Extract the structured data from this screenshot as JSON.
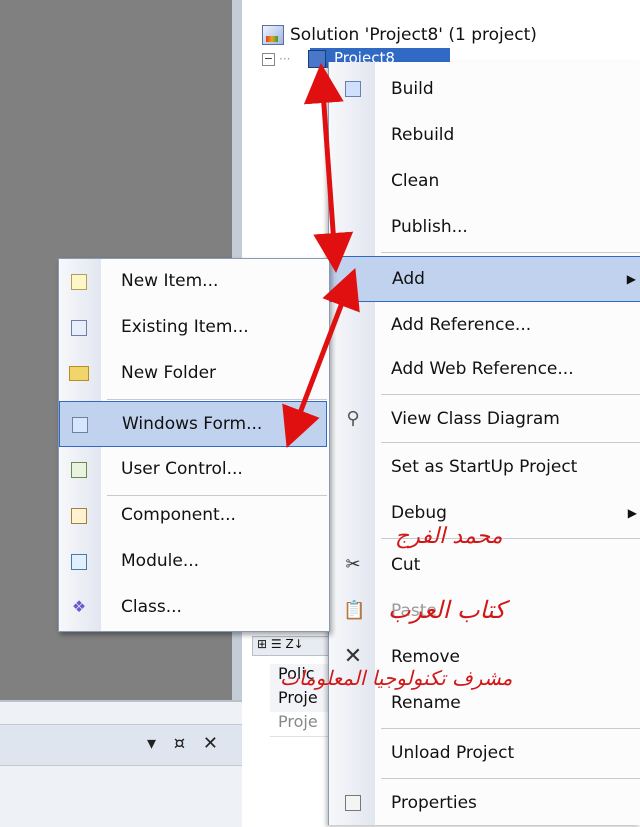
{
  "explorer": {
    "solution_label": "Solution 'Project8' (1 project)",
    "project_label": "Project8"
  },
  "context_menu": {
    "items": [
      {
        "label": "Build",
        "icon": "build-icon"
      },
      {
        "label": "Rebuild"
      },
      {
        "label": "Clean"
      },
      {
        "label": "Publish..."
      },
      {
        "label": "Add",
        "submenu": true,
        "highlighted": true
      },
      {
        "label": "Add Reference..."
      },
      {
        "label": "Add Web Reference..."
      },
      {
        "label": "View Class Diagram",
        "icon": "class-diagram-icon"
      },
      {
        "label": "Set as StartUp Project"
      },
      {
        "label": "Debug",
        "submenu": true
      },
      {
        "label": "Cut",
        "icon": "scissors-icon"
      },
      {
        "label": "Paste",
        "icon": "paste-icon",
        "disabled": true
      },
      {
        "label": "Remove",
        "icon": "remove-icon"
      },
      {
        "label": "Rename"
      },
      {
        "label": "Unload Project"
      },
      {
        "label": "Properties",
        "icon": "properties-icon"
      }
    ]
  },
  "add_submenu": {
    "items": [
      {
        "label": "New Item...",
        "icon": "new-item-icon"
      },
      {
        "label": "Existing Item...",
        "icon": "existing-item-icon"
      },
      {
        "label": "New Folder",
        "icon": "folder-icon"
      },
      {
        "label": "Windows Form...",
        "icon": "windows-form-icon",
        "highlighted": true
      },
      {
        "label": "User Control...",
        "icon": "user-control-icon"
      },
      {
        "label": "Component...",
        "icon": "component-icon"
      },
      {
        "label": "Module...",
        "icon": "module-icon"
      },
      {
        "label": "Class...",
        "icon": "class-icon"
      }
    ]
  },
  "properties_panel": {
    "row1": "Polic",
    "row2": "Proje",
    "row3": "Proje"
  },
  "bottom_panel": {
    "controls": "▾ ¤ ✕"
  },
  "overlay_text": {
    "line1": "محمد الفرج",
    "line2": "كتاب العرب",
    "line3": "مشرف تكنولوجيا المعلومات"
  },
  "colors": {
    "highlight": "#c1d2ee",
    "highlight_border": "#316ac5",
    "arrow": "#e01010",
    "overlay_text": "#d01818"
  }
}
